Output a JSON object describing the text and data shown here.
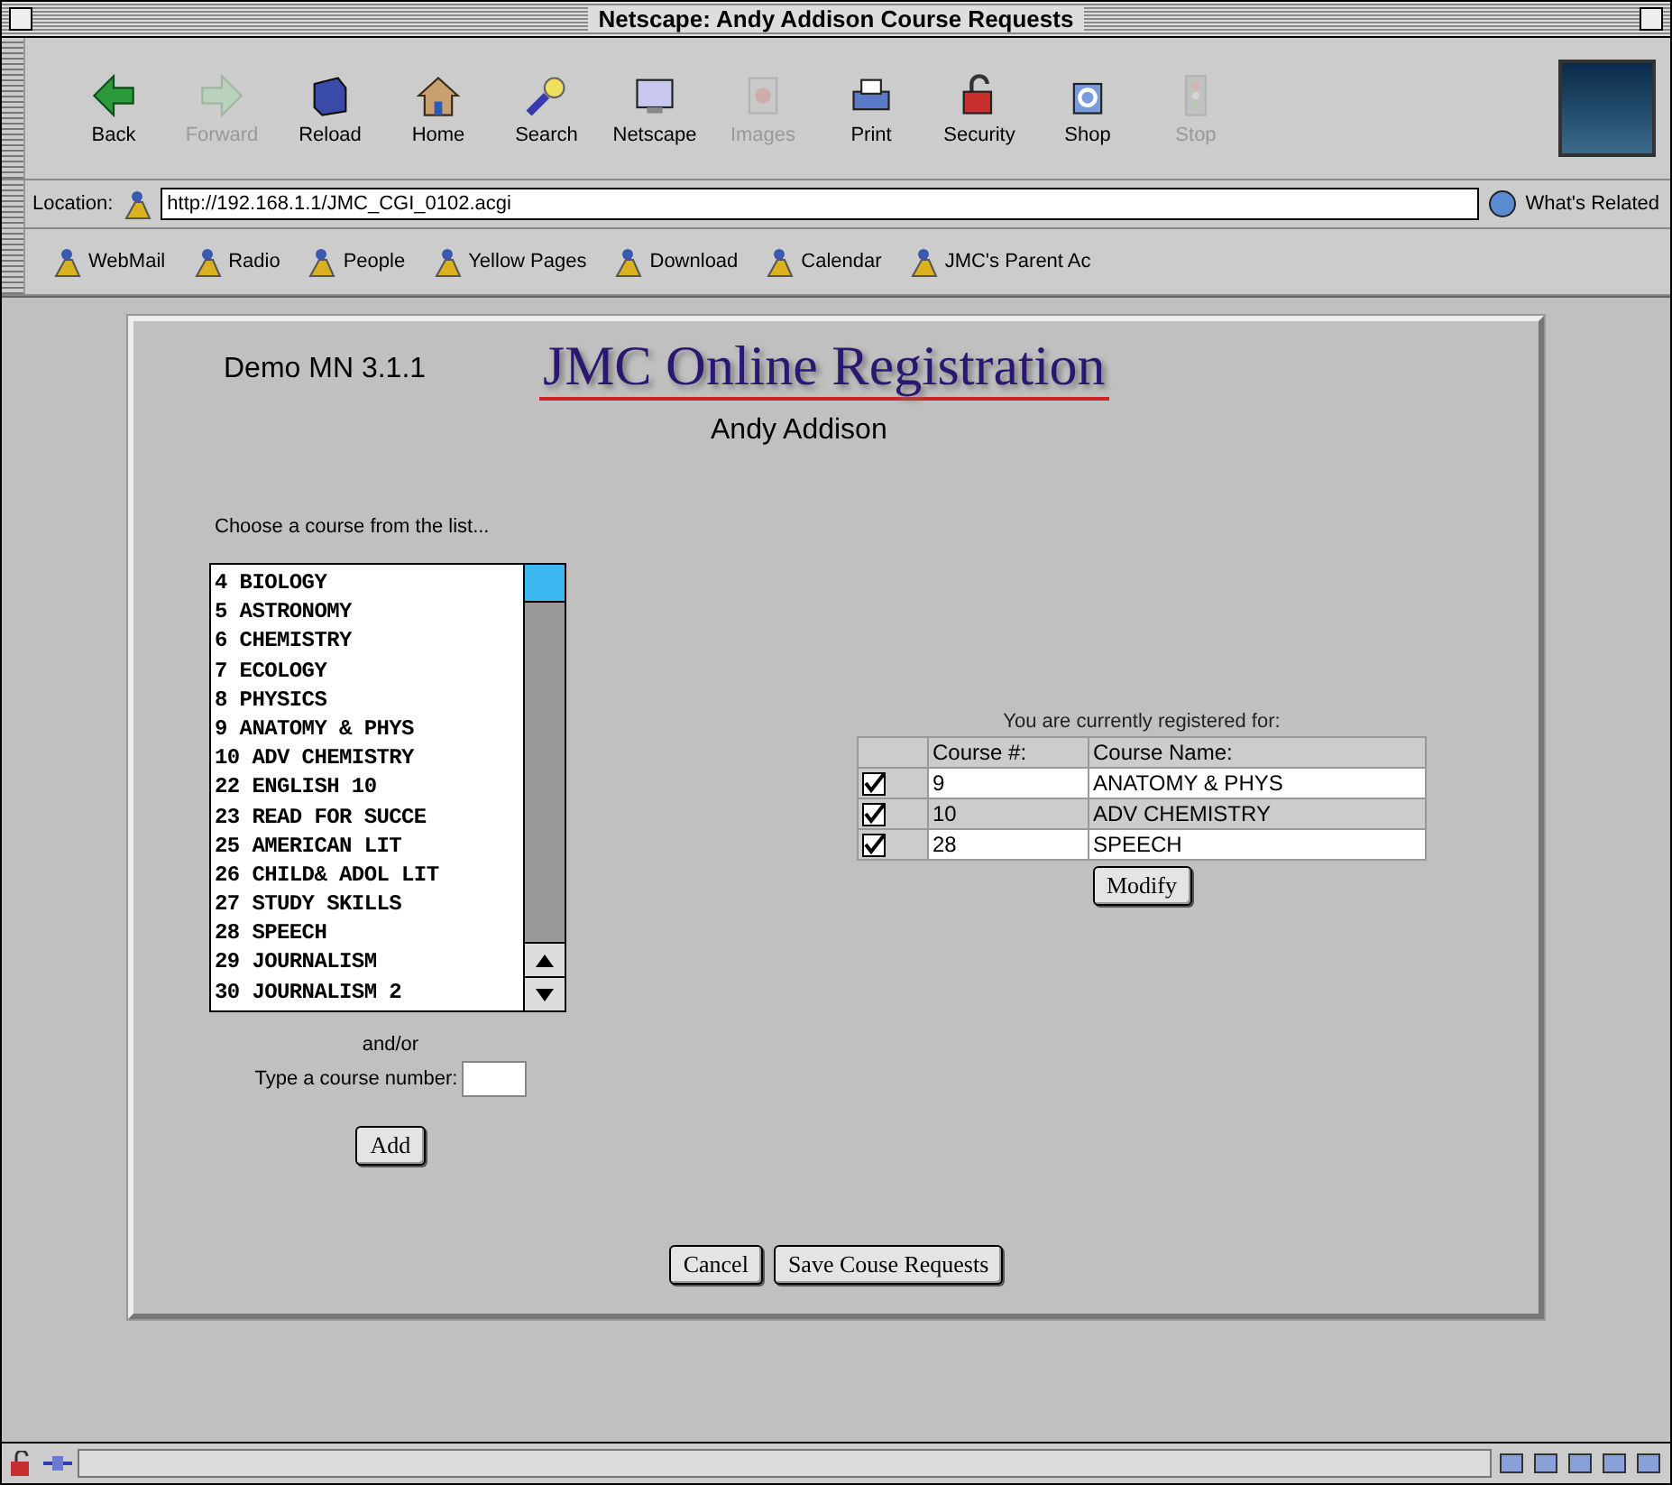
{
  "window": {
    "title": "Netscape: Andy Addison Course Requests"
  },
  "toolbar": [
    {
      "label": "Back",
      "disabled": false
    },
    {
      "label": "Forward",
      "disabled": true
    },
    {
      "label": "Reload",
      "disabled": false
    },
    {
      "label": "Home",
      "disabled": false
    },
    {
      "label": "Search",
      "disabled": false
    },
    {
      "label": "Netscape",
      "disabled": false
    },
    {
      "label": "Images",
      "disabled": true
    },
    {
      "label": "Print",
      "disabled": false
    },
    {
      "label": "Security",
      "disabled": false
    },
    {
      "label": "Shop",
      "disabled": false
    },
    {
      "label": "Stop",
      "disabled": true
    }
  ],
  "location": {
    "label": "Location:",
    "url": "http://192.168.1.1/JMC_CGI_0102.acgi",
    "related": "What's Related"
  },
  "bookmarks": [
    "WebMail",
    "Radio",
    "People",
    "Yellow Pages",
    "Download",
    "Calendar",
    "JMC's Parent Ac"
  ],
  "page": {
    "version": "Demo MN 3.1.1",
    "heading": "JMC Online Registration",
    "student": "Andy Addison",
    "choose_prompt": "Choose a course from the list...",
    "courses": [
      {
        "label": "4 BIOLOGY",
        "selected": false
      },
      {
        "label": "5 ASTRONOMY",
        "selected": false
      },
      {
        "label": "6 CHEMISTRY",
        "selected": false
      },
      {
        "label": "7 ECOLOGY",
        "selected": false
      },
      {
        "label": "8 PHYSICS",
        "selected": false
      },
      {
        "label": "9 ANATOMY & PHYS",
        "selected": false
      },
      {
        "label": "10 ADV CHEMISTRY",
        "selected": false
      },
      {
        "label": "22 ENGLISH 10",
        "selected": false
      },
      {
        "label": "23 READ FOR SUCCE",
        "selected": false
      },
      {
        "label": "25 AMERICAN LIT",
        "selected": false
      },
      {
        "label": "26 CHILD& ADOL LIT",
        "selected": false
      },
      {
        "label": "27 STUDY SKILLS",
        "selected": false
      },
      {
        "label": "28 SPEECH",
        "selected": false
      },
      {
        "label": "29 JOURNALISM",
        "selected": false
      },
      {
        "label": "30 JOURNALISM 2",
        "selected": false
      }
    ],
    "or_label": "and/or",
    "course_number_label": "Type a course number:",
    "add_button": "Add",
    "registered": {
      "caption": "You are currently registered for:",
      "columns": [
        "Course #:",
        "Course Name:"
      ],
      "rows": [
        {
          "checked": true,
          "number": "9",
          "name": "ANATOMY & PHYS"
        },
        {
          "checked": true,
          "number": "10",
          "name": "ADV CHEMISTRY"
        },
        {
          "checked": true,
          "number": "28",
          "name": "SPEECH"
        }
      ]
    },
    "modify_button": "Modify",
    "cancel_button": "Cancel",
    "save_button": "Save Couse Requests"
  }
}
